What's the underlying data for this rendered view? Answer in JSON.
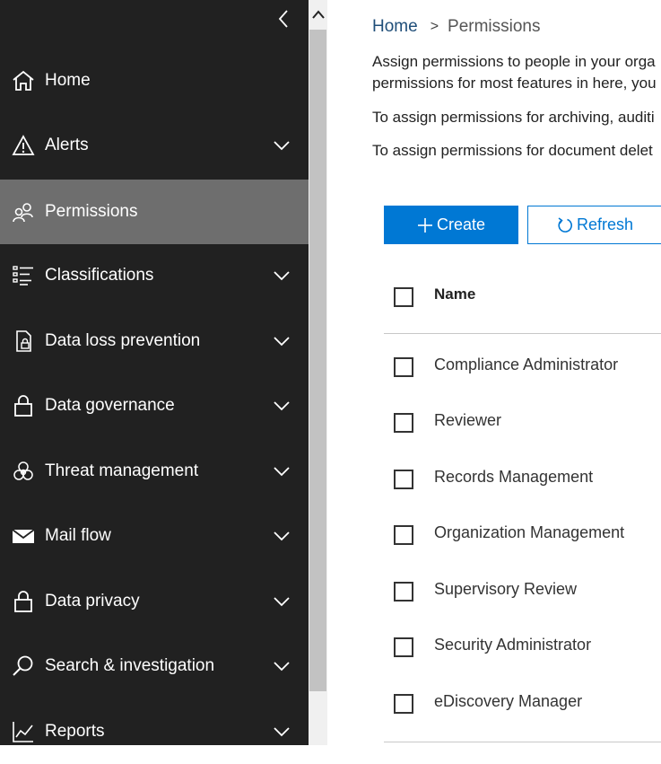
{
  "sidebar": {
    "items": [
      {
        "label": "Home",
        "icon": "home-icon",
        "expandable": false
      },
      {
        "label": "Alerts",
        "icon": "alert-icon",
        "expandable": true
      },
      {
        "label": "Permissions",
        "icon": "people-icon",
        "expandable": false,
        "active": true
      },
      {
        "label": "Classifications",
        "icon": "list-icon",
        "expandable": true
      },
      {
        "label": "Data loss prevention",
        "icon": "document-lock-icon",
        "expandable": true
      },
      {
        "label": "Data governance",
        "icon": "lock-icon",
        "expandable": true
      },
      {
        "label": "Threat management",
        "icon": "biohazard-icon",
        "expandable": true
      },
      {
        "label": "Mail flow",
        "icon": "mail-icon",
        "expandable": true
      },
      {
        "label": "Data privacy",
        "icon": "lock-icon",
        "expandable": true
      },
      {
        "label": "Search & investigation",
        "icon": "search-icon",
        "expandable": true
      },
      {
        "label": "Reports",
        "icon": "chart-icon",
        "expandable": true
      }
    ]
  },
  "breadcrumb": {
    "home": "Home",
    "separator": ">",
    "current": "Permissions"
  },
  "description": {
    "line1": "Assign permissions to people in your orga",
    "line2": "permissions for most features in here, you",
    "line3": "To assign permissions for archiving, auditi",
    "line4": "To assign permissions for document delet"
  },
  "toolbar": {
    "create_label": "Create",
    "refresh_label": "Refresh"
  },
  "table": {
    "column_name": "Name",
    "rows": [
      "Compliance Administrator",
      "Reviewer",
      "Records Management",
      "Organization Management",
      "Supervisory Review",
      "Security Administrator",
      "eDiscovery Manager"
    ]
  },
  "colors": {
    "sidebar_bg": "#212121",
    "active_bg": "#6e6e6e",
    "accent": "#0078d4",
    "link": "#1f4e79"
  }
}
